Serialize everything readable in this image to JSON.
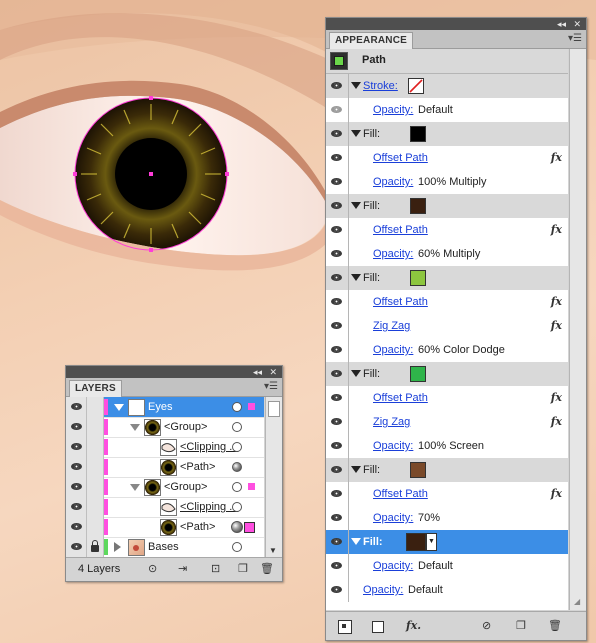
{
  "colors": {
    "selection": "#3c8ee6",
    "link": "#1a3fd9",
    "layer_pink": "#ff4fe0",
    "layer_green": "#5ed85e"
  },
  "appearance": {
    "tab_label": "APPEARANCE",
    "header_title": "Path",
    "rows": [
      {
        "kind": "stroke",
        "label": "Stroke:",
        "swatch": "none"
      },
      {
        "kind": "opacity",
        "label": "Opacity:",
        "value": "Default"
      },
      {
        "kind": "fill",
        "label": "Fill:",
        "swatch": "#000000"
      },
      {
        "kind": "effect",
        "label": "Offset Path"
      },
      {
        "kind": "opacity",
        "label": "Opacity:",
        "value": "100% Multiply"
      },
      {
        "kind": "fill",
        "label": "Fill:",
        "swatch": "#3a2010"
      },
      {
        "kind": "effect",
        "label": "Offset Path"
      },
      {
        "kind": "opacity",
        "label": "Opacity:",
        "value": "60% Multiply"
      },
      {
        "kind": "fill",
        "label": "Fill:",
        "swatch": "#8dc63f"
      },
      {
        "kind": "effect",
        "label": "Offset Path"
      },
      {
        "kind": "effect",
        "label": "Zig Zag"
      },
      {
        "kind": "opacity",
        "label": "Opacity:",
        "value": "60% Color Dodge"
      },
      {
        "kind": "fill",
        "label": "Fill:",
        "swatch": "#2fb44a"
      },
      {
        "kind": "effect",
        "label": "Offset Path"
      },
      {
        "kind": "effect",
        "label": "Zig Zag"
      },
      {
        "kind": "opacity",
        "label": "Opacity:",
        "value": "100% Screen"
      },
      {
        "kind": "fill",
        "label": "Fill:",
        "swatch": "#7a4a2a"
      },
      {
        "kind": "effect",
        "label": "Offset Path"
      },
      {
        "kind": "opacity",
        "label": "Opacity:",
        "value": "70%"
      },
      {
        "kind": "fill-selected",
        "label": "Fill:",
        "swatch": "#3a2010"
      },
      {
        "kind": "opacity",
        "label": "Opacity:",
        "value": "Default"
      },
      {
        "kind": "opacity-root",
        "label": "Opacity:",
        "value": "Default"
      }
    ],
    "fx_label": "fx"
  },
  "layers": {
    "tab_label": "LAYERS",
    "footer_count": "4 Layers",
    "rows": [
      {
        "name": "Eyes",
        "indent": 0,
        "expanded": true,
        "selected": true,
        "color": "#ff4fe0",
        "thumb": "layer",
        "target": "hollow",
        "sel_square": true,
        "underline": false
      },
      {
        "name": "<Group>",
        "indent": 1,
        "expanded": true,
        "selected": false,
        "color": "#ff4fe0",
        "thumb": "eye",
        "target": "hollow",
        "sel_square": false,
        "underline": false
      },
      {
        "name": "<Clipping ...",
        "indent": 2,
        "expanded": null,
        "selected": false,
        "color": "#ff4fe0",
        "thumb": "clip",
        "target": "hollow",
        "sel_square": false,
        "underline": true
      },
      {
        "name": "<Path>",
        "indent": 2,
        "expanded": null,
        "selected": false,
        "color": "#ff4fe0",
        "thumb": "eye",
        "target": "filled",
        "sel_square": false,
        "underline": false
      },
      {
        "name": "<Group>",
        "indent": 1,
        "expanded": true,
        "selected": false,
        "color": "#ff4fe0",
        "thumb": "eye",
        "target": "hollow",
        "sel_square": true,
        "underline": false
      },
      {
        "name": "<Clipping ...",
        "indent": 2,
        "expanded": null,
        "selected": false,
        "color": "#ff4fe0",
        "thumb": "clip",
        "target": "hollow",
        "sel_square": false,
        "underline": true
      },
      {
        "name": "<Path>",
        "indent": 2,
        "expanded": null,
        "selected": false,
        "color": "#ff4fe0",
        "thumb": "eye",
        "target": "filled-ring",
        "sel_square": true,
        "underline": false
      },
      {
        "name": "Bases",
        "indent": 0,
        "expanded": false,
        "selected": false,
        "color": "#5ed85e",
        "thumb": "bases",
        "target": "hollow",
        "sel_square": false,
        "underline": false,
        "locked": true
      }
    ]
  }
}
